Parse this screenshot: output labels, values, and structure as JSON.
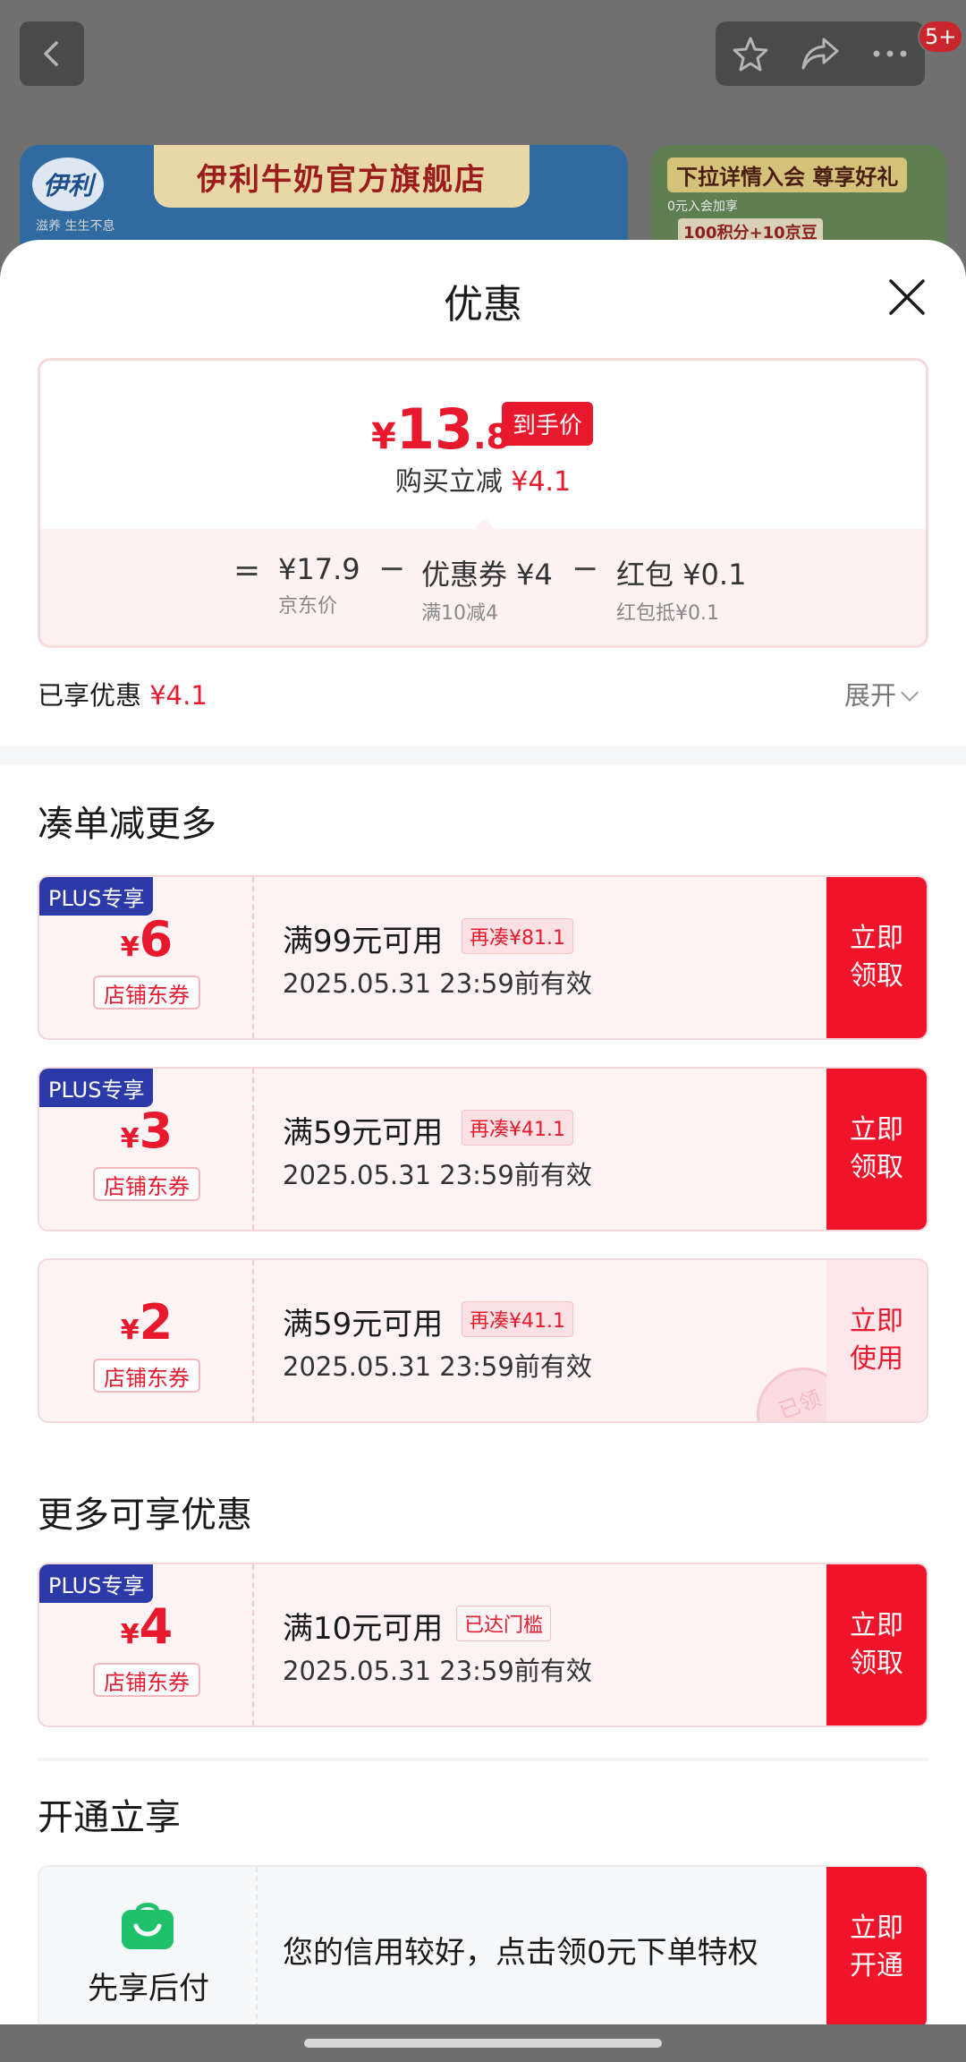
{
  "background": {
    "banner_left_title": "伊利牛奶官方旗舰店",
    "banner_left_logo": "伊利",
    "banner_left_logo_sub": "滋养 生生不息",
    "banner_right_title": "下拉详情入会 尊享好礼",
    "banner_right_sub1": "0元入会加享",
    "banner_right_sub2": "100积分+10京豆",
    "badge_count": "5+",
    "icons": [
      "back-icon",
      "star-icon",
      "share-icon",
      "more-icon"
    ]
  },
  "sheet": {
    "title": "优惠",
    "close_icon": "close-icon"
  },
  "price": {
    "currency": "¥",
    "integer": "13",
    "decimal": ".8",
    "tag": "到手价",
    "instant_label": "购买立减",
    "instant_value": "¥4.1",
    "equals": "=",
    "minus": "−",
    "jd_price": "¥17.9",
    "jd_label": "京东价",
    "coupon_value": "优惠券 ¥4",
    "coupon_label": "满10减4",
    "redpack_value": "红包 ¥0.1",
    "redpack_label": "红包抵¥0.1"
  },
  "summary": {
    "enjoyed_label": "已享优惠",
    "enjoyed_value": "¥4.1",
    "expand_label": "展开"
  },
  "sections": {
    "more_title": "凑单减更多",
    "other_title": "更多可享优惠",
    "open_title": "开通立享"
  },
  "coupons": [
    {
      "plus": "PLUS专享",
      "currency": "¥",
      "amount": "6",
      "store": "店铺东券",
      "condition": "满99元可用",
      "badge": "再凑¥81.1",
      "validity": "2025.05.31 23:59前有效",
      "action": "立即\n领取"
    },
    {
      "plus": "PLUS专享",
      "currency": "¥",
      "amount": "3",
      "store": "店铺东券",
      "condition": "满59元可用",
      "badge": "再凑¥41.1",
      "validity": "2025.05.31 23:59前有效",
      "action": "立即\n领取"
    },
    {
      "currency": "¥",
      "amount": "2",
      "store": "店铺东券",
      "condition": "满59元可用",
      "badge": "再凑¥41.1",
      "validity": "2025.05.31 23:59前有效",
      "action": "立即\n使用",
      "stamp": "已领"
    },
    {
      "plus": "PLUS专享",
      "currency": "¥",
      "amount": "4",
      "store": "店铺东券",
      "condition": "满10元可用",
      "badge": "已达门槛",
      "validity": "2025.05.31 23:59前有效",
      "action": "立即\n领取"
    }
  ],
  "pay_later": {
    "label": "先享后付",
    "text": "您的信用较好，点击领0元下单特权",
    "action": "立即\n开通",
    "icon": "shopping-bag-icon"
  },
  "colors": {
    "accent": "#e8192c",
    "button": "#f0142b",
    "plus": "#2c3aa8"
  }
}
